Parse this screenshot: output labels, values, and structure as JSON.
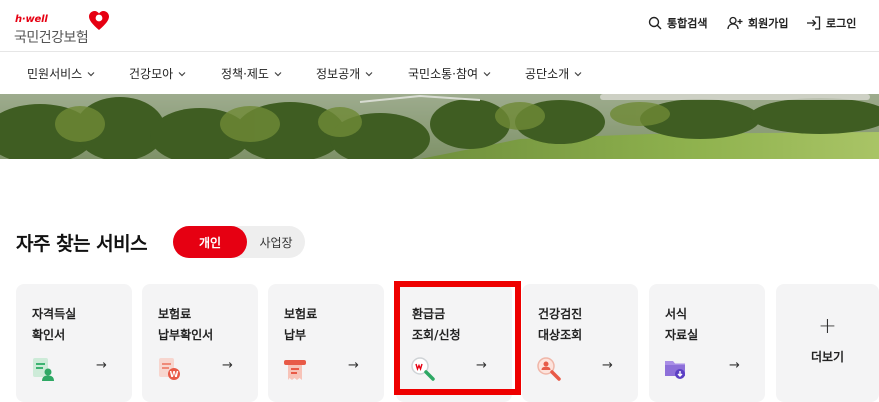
{
  "header": {
    "logo_small": "h·well",
    "logo_main": "국민건강보험",
    "util": {
      "search": "통합검색",
      "join": "회원가입",
      "login": "로그인"
    }
  },
  "nav": {
    "items": [
      {
        "label": "민원서비스"
      },
      {
        "label": "건강모아"
      },
      {
        "label": "정책·제도"
      },
      {
        "label": "정보공개"
      },
      {
        "label": "국민소통·참여"
      },
      {
        "label": "공단소개"
      }
    ]
  },
  "services": {
    "title": "자주 찾는 서비스",
    "toggle": {
      "active": "개인",
      "inactive": "사업장"
    },
    "cards": [
      {
        "label": "자격득실\n확인서",
        "icon": "certificate-person-icon",
        "arrow": "→"
      },
      {
        "label": "보험료\n납부확인서",
        "icon": "payment-document-icon",
        "arrow": "→"
      },
      {
        "label": "보험료\n납부",
        "icon": "payment-receipt-icon",
        "arrow": "→"
      },
      {
        "label": "환급금\n조회/신청",
        "icon": "refund-search-icon",
        "arrow": "→"
      },
      {
        "label": "건강검진\n대상조회",
        "icon": "checkup-search-icon",
        "arrow": "→"
      },
      {
        "label": "서식\n자료실",
        "icon": "folder-download-icon",
        "arrow": "→"
      }
    ],
    "more": {
      "symbol": "+",
      "label": "더보기"
    }
  },
  "colors": {
    "brand": "#e60012",
    "highlight": "#ee0000",
    "card_bg": "#f4f4f5"
  }
}
